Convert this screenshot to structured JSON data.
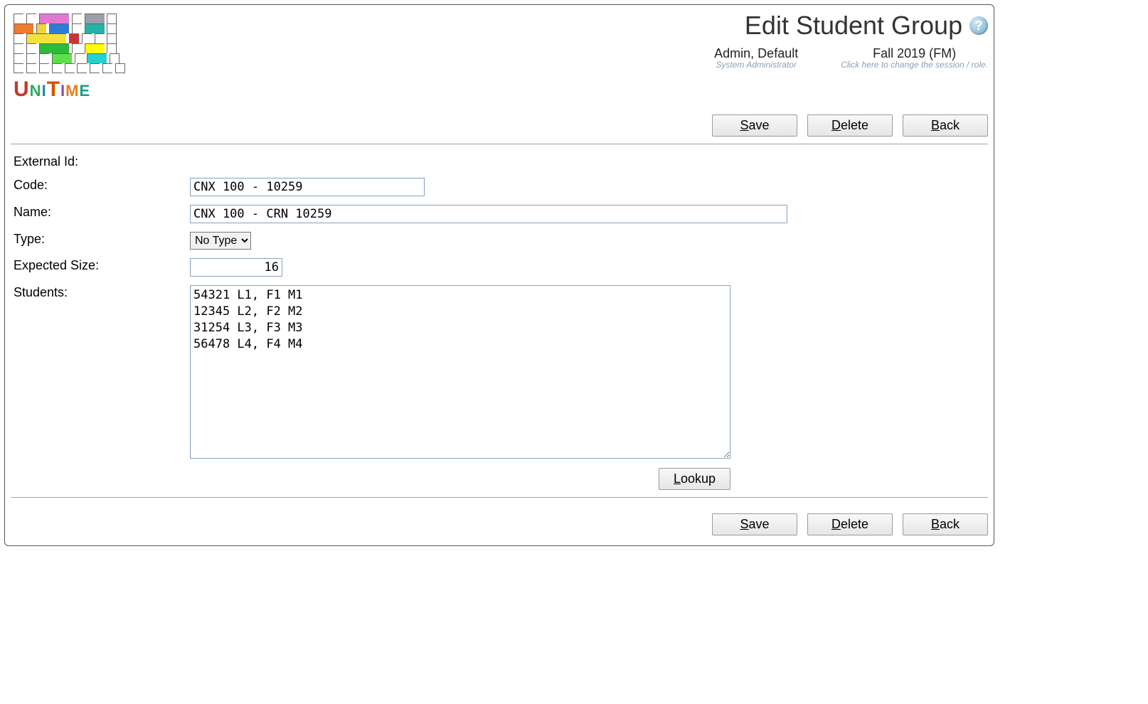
{
  "header": {
    "title": "Edit Student Group",
    "user_name": "Admin, Default",
    "user_role": "System Administrator",
    "session_name": "Fall 2019 (FM)",
    "session_hint": "Click here to change the session / role.",
    "logo_text": "UNITIME"
  },
  "buttons": {
    "save": "Save",
    "delete": "Delete",
    "back": "Back",
    "lookup": "Lookup"
  },
  "labels": {
    "external_id": "External Id:",
    "code": "Code:",
    "name": "Name:",
    "type": "Type:",
    "expected_size": "Expected Size:",
    "students": "Students:"
  },
  "form": {
    "external_id": "",
    "code": "CNX 100 - 10259",
    "name": "CNX 100 - CRN 10259",
    "type_selected": "No Type",
    "type_options": [
      "No Type"
    ],
    "expected_size": "16",
    "students": "54321 L1, F1 M1\n12345 L2, F2 M2\n31254 L3, F3 M3\n56478 L4, F4 M4"
  }
}
